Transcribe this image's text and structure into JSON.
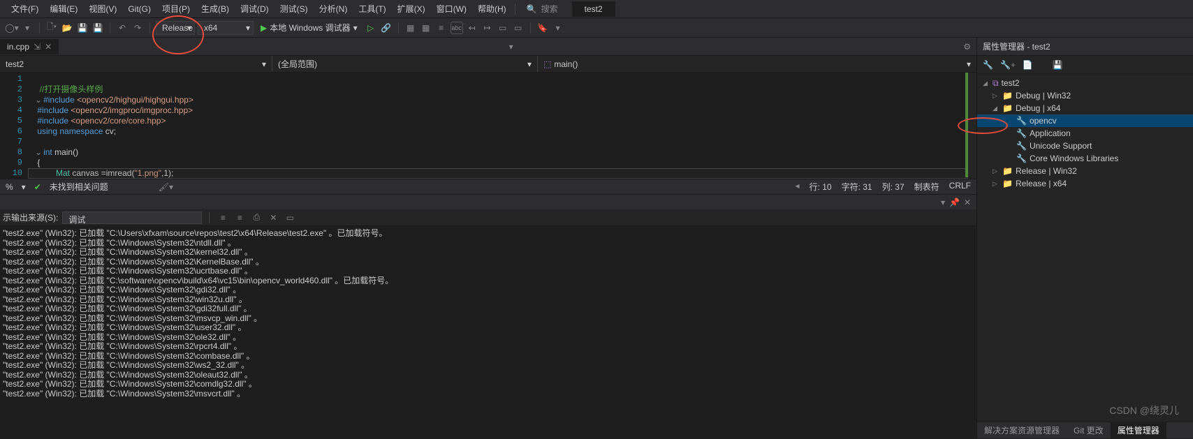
{
  "menu": [
    "文件(F)",
    "编辑(E)",
    "视图(V)",
    "Git(G)",
    "项目(P)",
    "生成(B)",
    "调试(D)",
    "测试(S)",
    "分析(N)",
    "工具(T)",
    "扩展(X)",
    "窗口(W)",
    "帮助(H)"
  ],
  "search_label": "搜索",
  "top_tab": "test2",
  "config": "Release",
  "platform": "x64",
  "debug_btn": "本地 Windows 调试器",
  "doc_tab": "in.cpp",
  "nav": {
    "project": "test2",
    "scope": "(全局范围)",
    "func": "main()"
  },
  "code": {
    "lines": [
      "",
      "//打开摄像头样例",
      "#include <opencv2/highgui/highgui.hpp>",
      "#include <opencv2/imgproc/imgproc.hpp>",
      "#include <opencv2/core/core.hpp>",
      "using namespace cv;",
      "",
      "int main()",
      "{",
      "        Mat canvas =imread(\"1.png\",1);"
    ]
  },
  "errors": "未找到相关问题",
  "status": {
    "line": "行: 10",
    "char": "字符: 31",
    "col": "列: 37",
    "tabs": "制表符",
    "crlf": "CRLF",
    "pct": "%"
  },
  "output_label": "示输出来源(S):",
  "output_src": "调试",
  "output": [
    "test2.exe\" (Win32): 已加载 \"C:\\Users\\xfxam\\source\\repos\\test2\\x64\\Release\\test2.exe\" 。已加载符号。",
    "test2.exe\" (Win32): 已加载 \"C:\\Windows\\System32\\ntdll.dll\" 。",
    "test2.exe\" (Win32): 已加载 \"C:\\Windows\\System32\\kernel32.dll\" 。",
    "test2.exe\" (Win32): 已加载 \"C:\\Windows\\System32\\KernelBase.dll\" 。",
    "test2.exe\" (Win32): 已加载 \"C:\\Windows\\System32\\ucrtbase.dll\" 。",
    "test2.exe\" (Win32): 已加载 \"C:\\software\\opencv\\build\\x64\\vc15\\bin\\opencv_world460.dll\" 。已加载符号。",
    "test2.exe\" (Win32): 已加载 \"C:\\Windows\\System32\\gdi32.dll\" 。",
    "test2.exe\" (Win32): 已加载 \"C:\\Windows\\System32\\win32u.dll\" 。",
    "test2.exe\" (Win32): 已加载 \"C:\\Windows\\System32\\gdi32full.dll\" 。",
    "test2.exe\" (Win32): 已加载 \"C:\\Windows\\System32\\msvcp_win.dll\" 。",
    "test2.exe\" (Win32): 已加载 \"C:\\Windows\\System32\\user32.dll\" 。",
    "test2.exe\" (Win32): 已加载 \"C:\\Windows\\System32\\ole32.dll\" 。",
    "test2.exe\" (Win32): 已加载 \"C:\\Windows\\System32\\rpcrt4.dll\" 。",
    "test2.exe\" (Win32): 已加载 \"C:\\Windows\\System32\\combase.dll\" 。",
    "test2.exe\" (Win32): 已加载 \"C:\\Windows\\System32\\ws2_32.dll\" 。",
    "test2.exe\" (Win32): 已加载 \"C:\\Windows\\System32\\oleaut32.dll\" 。",
    "test2.exe\" (Win32): 已加载 \"C:\\Windows\\System32\\comdlg32.dll\" 。",
    "test2.exe\" (Win32): 已加载 \"C:\\Windows\\System32\\msvcrt.dll\" 。"
  ],
  "prop": {
    "title": "属性管理器 - test2",
    "root": "test2",
    "items": [
      "Debug | Win32",
      "Debug | x64"
    ],
    "sub": [
      "opencv",
      "Application",
      "Unicode Support",
      "Core Windows Libraries"
    ],
    "items2": [
      "Release | Win32",
      "Release | x64"
    ]
  },
  "bottom_tabs": [
    "解决方案资源管理器",
    "Git 更改",
    "属性管理器"
  ],
  "watermark": "CSDN @绕灵儿"
}
